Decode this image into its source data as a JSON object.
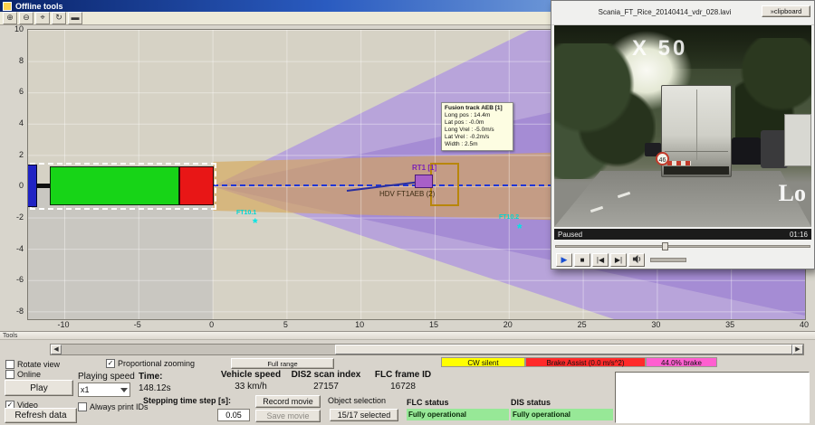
{
  "window": {
    "title": "Offline tools"
  },
  "toolbar": {
    "buttons": [
      "zoom-in",
      "zoom-out",
      "pan",
      "rotate",
      "data-cursor"
    ]
  },
  "plot": {
    "x_ticks": [
      "-10",
      "-5",
      "0",
      "5",
      "10",
      "15",
      "20",
      "25",
      "30",
      "35",
      "40"
    ],
    "y_ticks": [
      "10",
      "8",
      "6",
      "4",
      "2",
      "0",
      "-2",
      "-4",
      "-6",
      "-8"
    ],
    "datatip": {
      "title": "Fusion track AEB [1]",
      "lines": [
        "Long pos : 14.4m",
        "Lat pos : -0.0m",
        "Long Vrel : -5.0m/s",
        "Lat Vrel : -0.2m/s",
        "Width : 2.5m"
      ]
    },
    "labels": {
      "radar_track": "RT1 [1]",
      "fusion_track": "HDV FT1AEB  (2)",
      "ft_left": "FT10.1",
      "ft_right": "FT10.2"
    }
  },
  "video": {
    "title": "Scania_FT_Rice_20140414_vdr_028.lavi",
    "clipboard_button": "»clipboard",
    "status": "Paused",
    "time": "01:16",
    "sign": "46",
    "overlay_top": "X 50",
    "overlay_bottom": "Lo"
  },
  "tools": {
    "panel_title": "Tools",
    "full_range_button": "Full range",
    "checkboxes": {
      "rotate_view": "Rotate view",
      "online": "Online",
      "video": "Video",
      "always_print_ids": "Always print IDs",
      "proportional_zooming": "Proportional zooming"
    },
    "play_button": "Play",
    "refresh_button": "Refresh data",
    "playing_speed_label": "Playing speed",
    "playing_speed_value": "x1",
    "time_label": "Time:",
    "time_value": "148.12s",
    "stepping_label": "Stepping time step [s]:",
    "stepping_value": "0.05",
    "vehicle_speed_label": "Vehicle speed",
    "vehicle_speed_value": "33 km/h",
    "dis2_label": "DIS2 scan index",
    "dis2_value": "27157",
    "flc_frame_label": "FLC frame ID",
    "flc_frame_value": "16728",
    "record_button": "Record movie",
    "save_button": "Save movie",
    "object_selection_label": "Object selection",
    "object_selection_button": "15/17 selected",
    "status_strips": {
      "cw": "CW silent",
      "brake_assist": "Brake Assist (0.0 m/s^2)",
      "brake_pct": "44.0% brake"
    },
    "flc_status_label": "FLC status",
    "flc_status_value": "Fully operational",
    "dis_status_label": "DIS status",
    "dis_status_value": "Fully operational"
  },
  "colors": {
    "cw_bg": "#ffff00",
    "brake_assist_bg": "#ff2a2a",
    "brake_pct_bg": "#ff5fd0",
    "status_ok_bg": "#97e897",
    "vehicle_trailer": "#17d417",
    "vehicle_tractor": "#e81616",
    "vehicle_rear": "#2023c4",
    "fov_purple": "#b098de",
    "corridor_tan": "#d6a654",
    "track_blue": "#2136d6"
  }
}
